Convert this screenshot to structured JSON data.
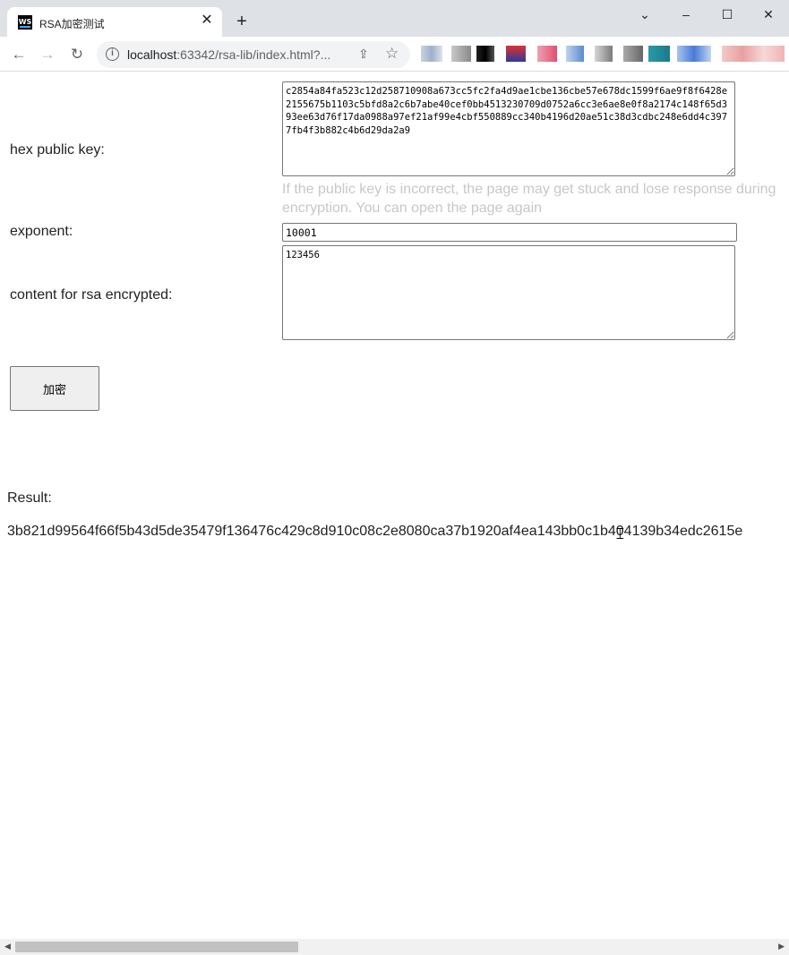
{
  "browser": {
    "tab_title": "RSA加密测试",
    "favicon_text": "WS",
    "new_tab_glyph": "+",
    "close_glyph": "✕",
    "url_host": "localhost",
    "url_path": ":63342/rsa-lib/index.html?...",
    "window_buttons": {
      "dropdown": "⌄",
      "minimize": "–",
      "maximize": "☐",
      "close": "✕"
    }
  },
  "form": {
    "public_key_label": "hex public key:",
    "public_key_value": "c2854a84fa523c12d258710908a673cc5fc2fa4d9ae1cbe136cbe57e678dc1599f6ae9f8f6428e2155675b1103c5bfd8a2c6b7abe40cef0bb4513230709d0752a6cc3e6ae8e0f8a2174c148f65d393ee63d76f17da0988a97ef21af99e4cbf550889cc340b4196d20ae51c38d3cdbc248e6dd4c3977fb4f3b882c4b6d29da2a9",
    "hint": "If the public key is incorrect, the page may get stuck and lose response during encryption. You can open the page again",
    "exponent_label": "exponent:",
    "exponent_value": "10001",
    "content_label": "content for rsa encrypted:",
    "content_value": "123456",
    "encrypt_button": "加密"
  },
  "result": {
    "label": "Result:",
    "value": "3b821d99564f66f5b43d5de35479f136476c429c8d910c08c2e8080ca37b1920af4ea143bb0c1b404139b34edc2615e"
  },
  "colors": {
    "hint": "#c7c7c7",
    "chrome_bg": "#dee1e6",
    "omnibox_bg": "#f1f3f4"
  }
}
